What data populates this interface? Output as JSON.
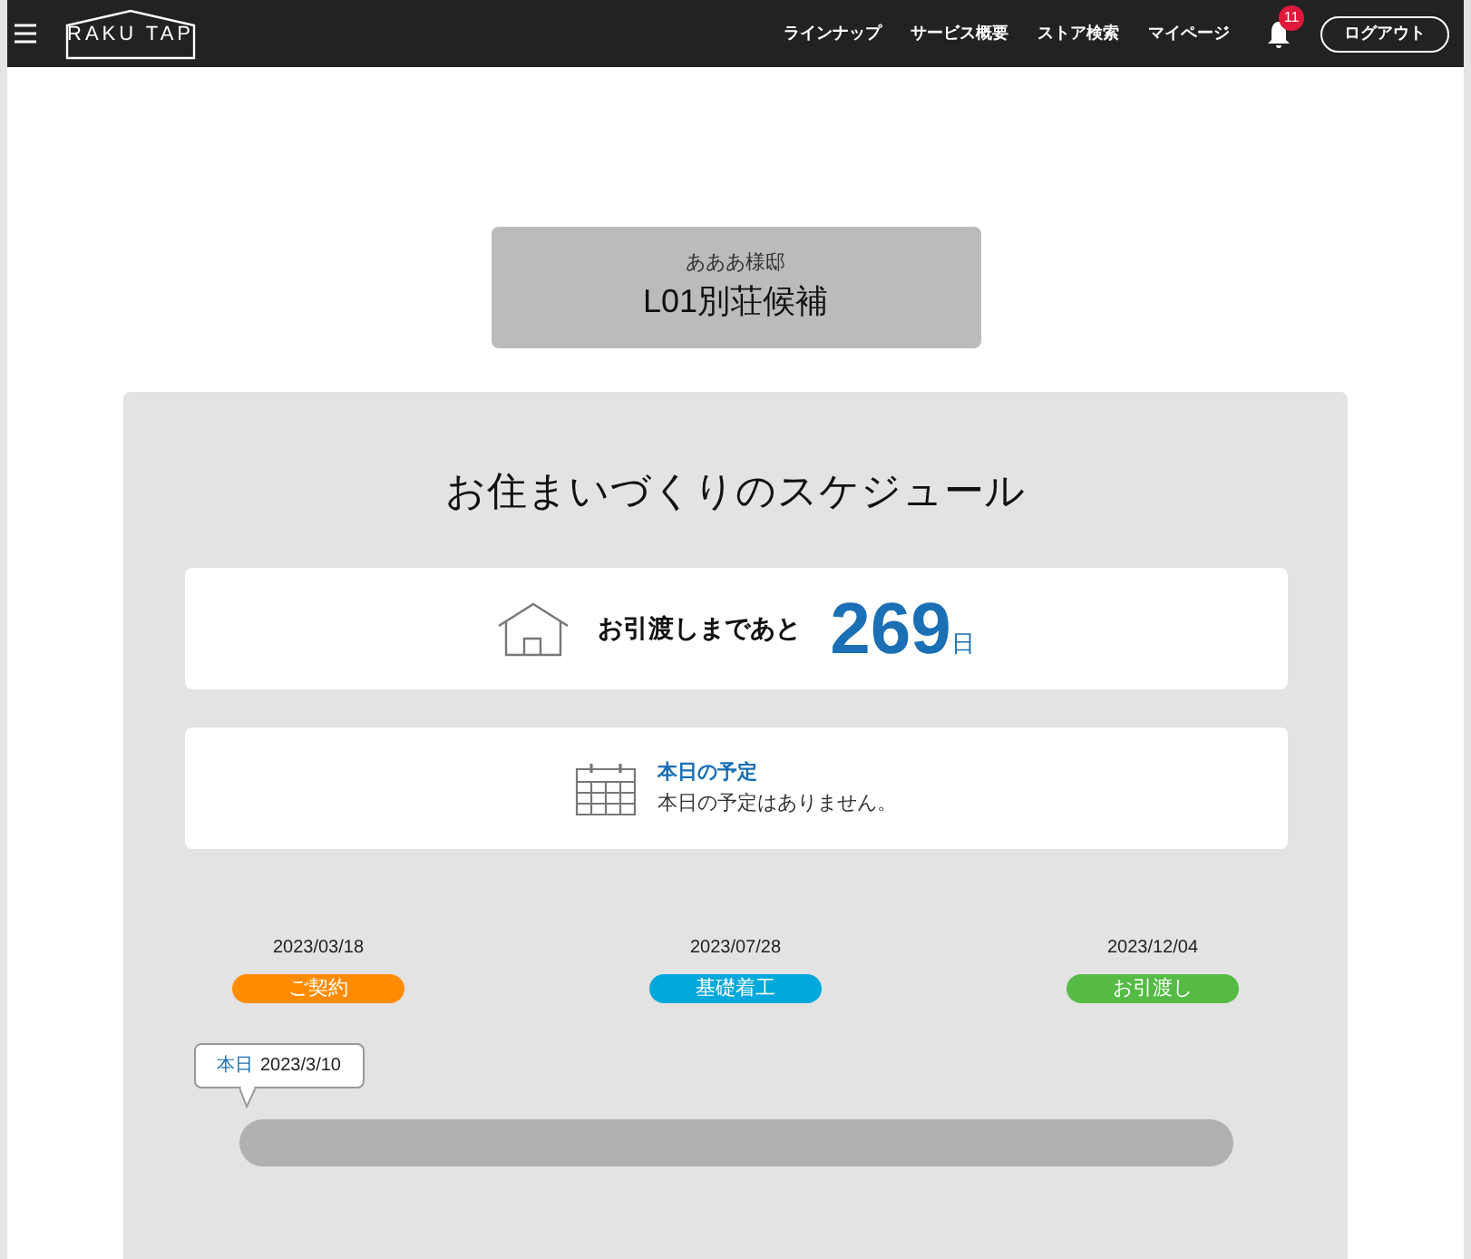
{
  "header": {
    "logo": "RAKU TAP",
    "nav": [
      "ラインナップ",
      "サービス概要",
      "ストア検索",
      "マイページ"
    ],
    "notification_count": "11",
    "logout": "ログアウト"
  },
  "property": {
    "owner": "あああ様邸",
    "name": "L01別荘候補"
  },
  "schedule": {
    "title": "お住まいづくりのスケジュール",
    "countdown": {
      "label": "お引渡しまであと",
      "days": "269",
      "unit": "日"
    },
    "today": {
      "heading": "本日の予定",
      "message": "本日の予定はありません。"
    },
    "milestones": [
      {
        "date": "2023/03/18",
        "label": "ご契約",
        "color": "#ff8c00"
      },
      {
        "date": "2023/07/28",
        "label": "基礎着工",
        "color": "#00a8dc"
      },
      {
        "date": "2023/12/04",
        "label": "お引渡し",
        "color": "#55bb44"
      }
    ],
    "marker": {
      "label": "本日",
      "date": "2023/3/10"
    }
  }
}
